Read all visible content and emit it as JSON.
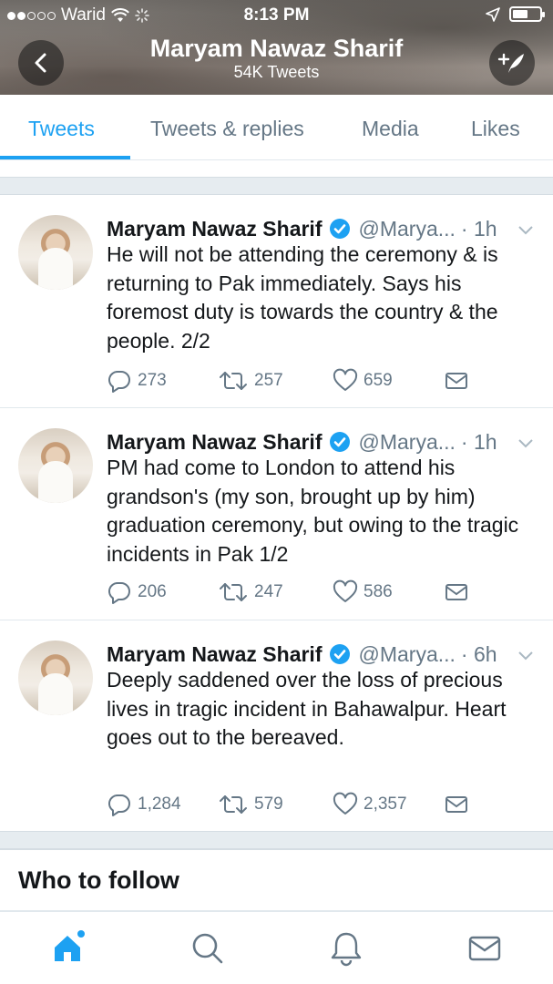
{
  "status": {
    "carrier": "Warid",
    "time": "8:13 PM"
  },
  "profile": {
    "name": "Maryam Nawaz Sharif",
    "tweet_count": "54K Tweets"
  },
  "tabs": [
    {
      "label": "Tweets",
      "active": true
    },
    {
      "label": "Tweets & replies",
      "active": false
    },
    {
      "label": "Media",
      "active": false
    },
    {
      "label": "Likes",
      "active": false
    }
  ],
  "tweets": [
    {
      "name": "Maryam Nawaz Sharif",
      "handle": "@Marya...",
      "time": "· 1h",
      "text": "He will not be attending the ceremony & is returning to Pak immediately. Says his foremost duty is towards the country & the people. 2/2",
      "replies": "273",
      "retweets": "257",
      "likes": "659"
    },
    {
      "name": "Maryam Nawaz Sharif",
      "handle": "@Marya...",
      "time": "· 1h",
      "text": "PM had come to London to attend his grandson's (my son, brought up by him) graduation ceremony, but owing to the tragic incidents in Pak 1/2",
      "replies": "206",
      "retweets": "247",
      "likes": "586"
    },
    {
      "name": "Maryam Nawaz Sharif",
      "handle": "@Marya...",
      "time": "· 6h",
      "text": "Deeply saddened over the loss of precious lives in tragic incident in Bahawalpur. Heart goes out to the bereaved.",
      "replies": "1,284",
      "retweets": "579",
      "likes": "2,357"
    }
  ],
  "who_to_follow": {
    "title": "Who to follow"
  },
  "colors": {
    "accent": "#1da1f2",
    "muted": "#657786",
    "divider": "#e1e8ed"
  },
  "icons": [
    "back-arrow-icon",
    "compose-tweet-icon",
    "verified-icon",
    "caret-down-icon",
    "reply-icon",
    "retweet-icon",
    "like-icon",
    "direct-message-icon",
    "home-icon",
    "search-icon",
    "notifications-icon",
    "messages-icon"
  ]
}
